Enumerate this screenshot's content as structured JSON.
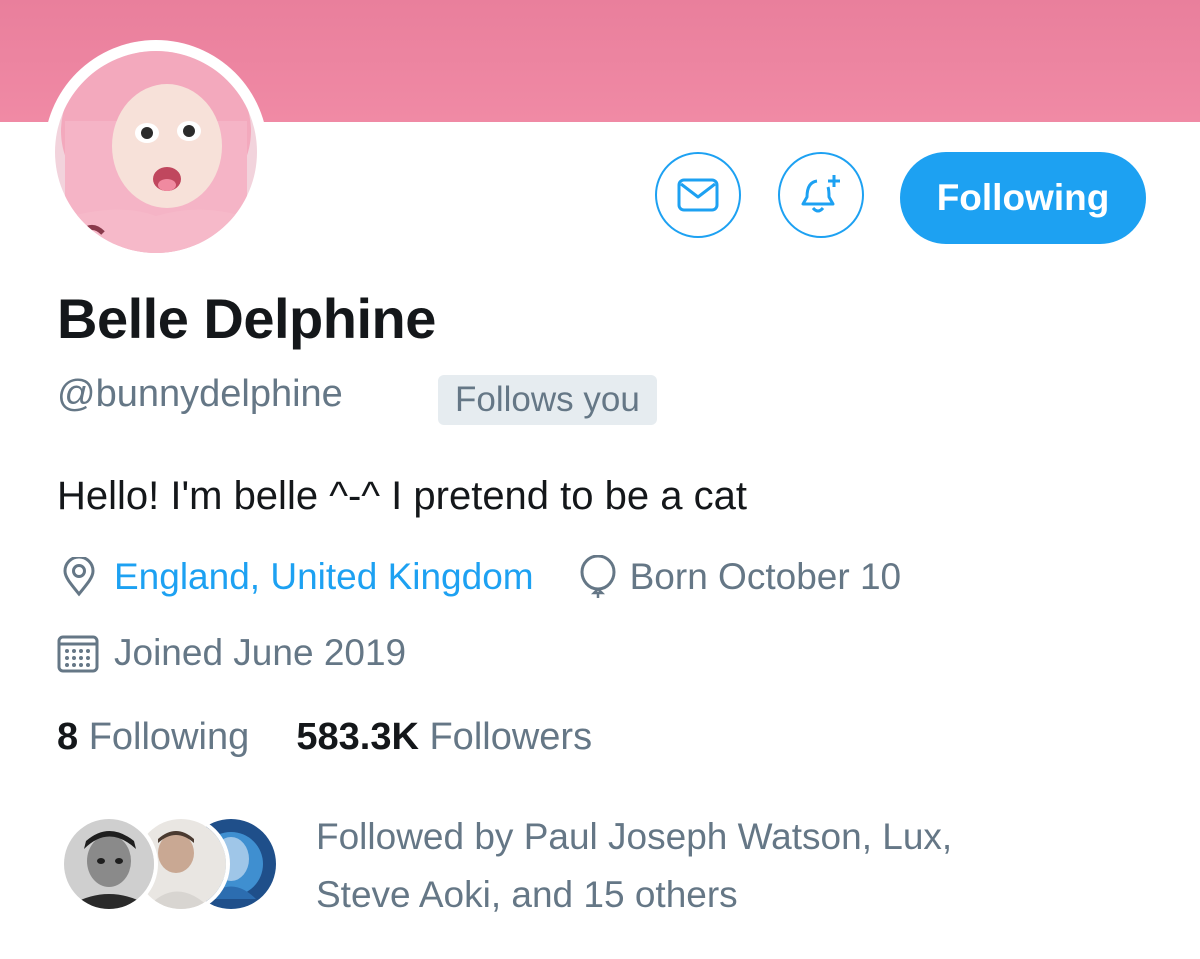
{
  "profile": {
    "name": "Belle Delphine",
    "handle": "@bunnydelphine",
    "follows_you": "Follows you",
    "bio": "Hello! I'm belle ^-^ I pretend to be a cat",
    "location": "England, United Kingdom",
    "birthday": "Born October 10",
    "joined": "Joined June 2019"
  },
  "actions": {
    "message_icon": "envelope-icon",
    "notify_icon": "bell-plus-icon",
    "follow_label": "Following"
  },
  "stats": {
    "following_count": "8",
    "following_label": "Following",
    "followers_count": "583.3K",
    "followers_label": "Followers"
  },
  "followed_by": {
    "text_line1": "Followed by Paul Joseph Watson, Lux,",
    "text_line2": "Steve Aoki, and 15 others"
  },
  "colors": {
    "banner": "#f08aa5",
    "accent": "#1da1f2",
    "secondary_text": "#657786",
    "primary_text": "#14171a",
    "badge_bg": "#e6ecf0"
  }
}
